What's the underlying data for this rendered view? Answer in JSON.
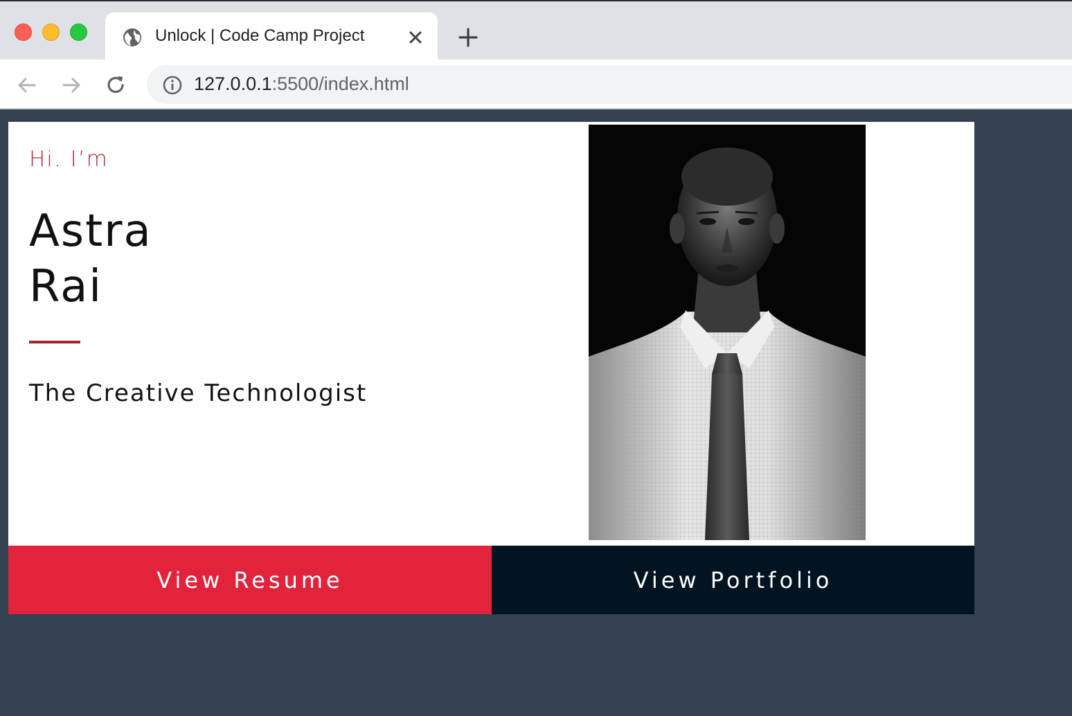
{
  "browser": {
    "tab_title": "Unlock | Code Camp Project",
    "url_host": "127.0.0.1",
    "url_path": ":5500/index.html",
    "icons": [
      "globe-icon",
      "close-icon",
      "plus-icon",
      "back-arrow-icon",
      "forward-arrow-icon",
      "reload-icon",
      "info-icon"
    ]
  },
  "hero": {
    "greeting": "Hi. I’m",
    "first_name": "Astra",
    "last_name": "Rai",
    "tagline": "The Creative Technologist",
    "accent_color": "#b02a37"
  },
  "actions": {
    "resume_label": "View Resume",
    "portfolio_label": "View Portfolio",
    "resume_color": "#e2233b",
    "portfolio_color": "#021321"
  },
  "colors": {
    "page_background": "#34414f"
  }
}
